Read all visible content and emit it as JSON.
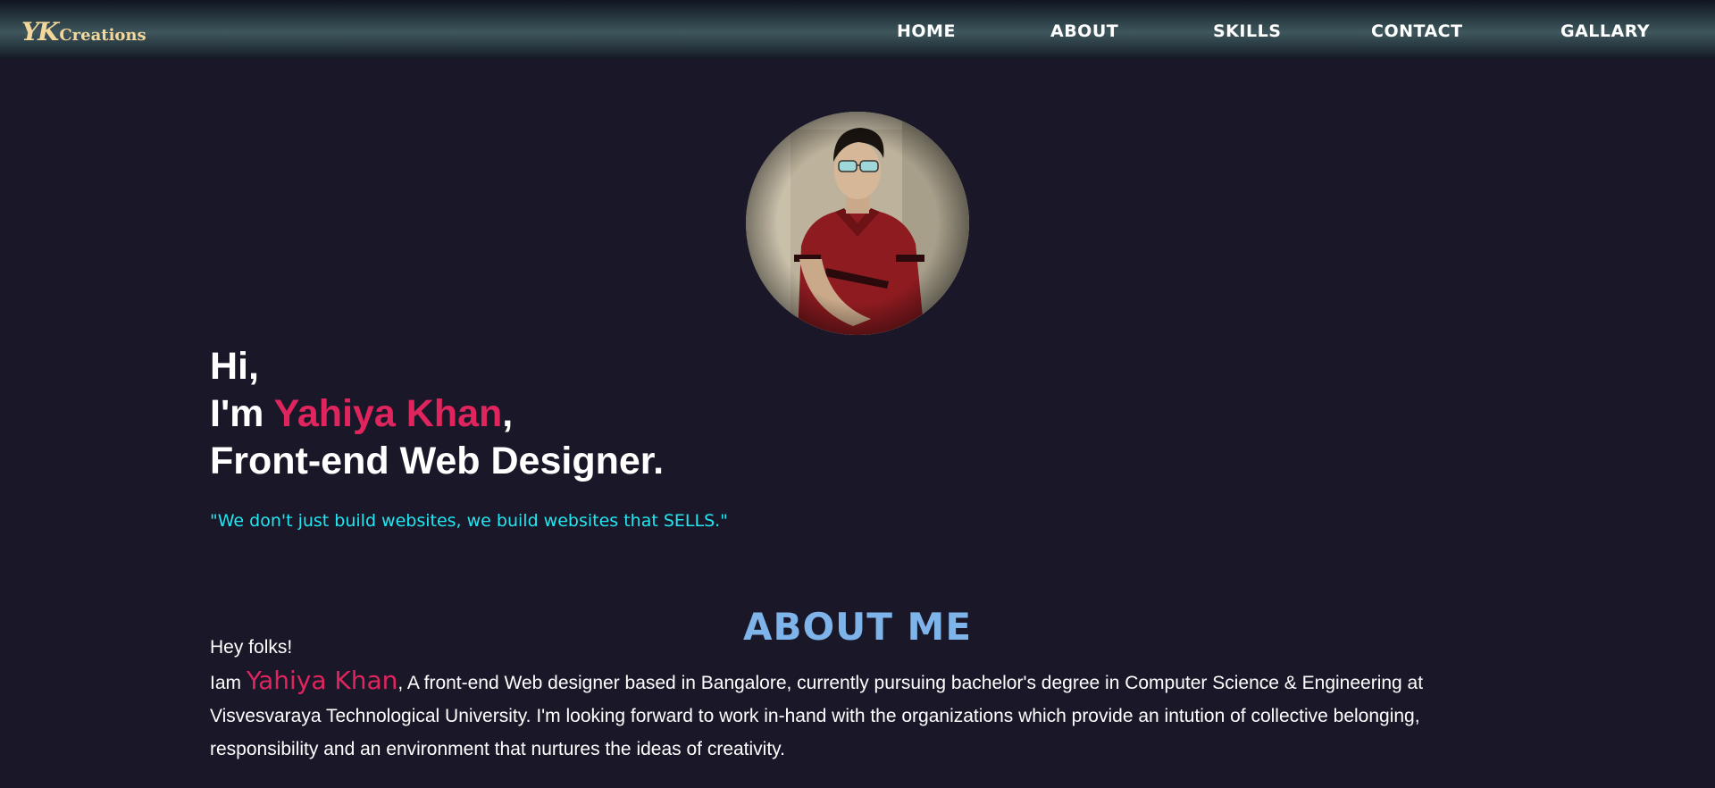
{
  "brand": {
    "mark": "YK",
    "word": "Creations",
    "color": "#f3d79c"
  },
  "nav": {
    "items": [
      {
        "label": "HOME"
      },
      {
        "label": "ABOUT"
      },
      {
        "label": "SKILLS"
      },
      {
        "label": "CONTACT"
      },
      {
        "label": "GALLARY"
      }
    ]
  },
  "hero": {
    "greeting": "Hi,",
    "intro_prefix": "I'm ",
    "name": "Yahiya Khan",
    "intro_suffix": ",",
    "role": "Front-end Web Designer.",
    "tagline": "\"We don't just build websites, we build websites that SELLS.\""
  },
  "about": {
    "title": "ABOUT ME",
    "greeting": "Hey folks!",
    "lead": "Iam ",
    "name": "Yahiya Khan",
    "body": ", A front-end Web designer based in Bangalore, currently pursuing bachelor's degree in Computer Science & Engineering at Visvesvaraya Technological University. I'm looking forward to work in-hand with the organizations which provide an intution of collective belonging, responsibility and an environment that nurtures the ideas of creativity."
  },
  "colors": {
    "background": "#1a1828",
    "accent": "#e0245e",
    "tagline": "#22e6f0",
    "section_title": "#7fb4ea"
  },
  "icons": {
    "profile": "profile-photo"
  }
}
